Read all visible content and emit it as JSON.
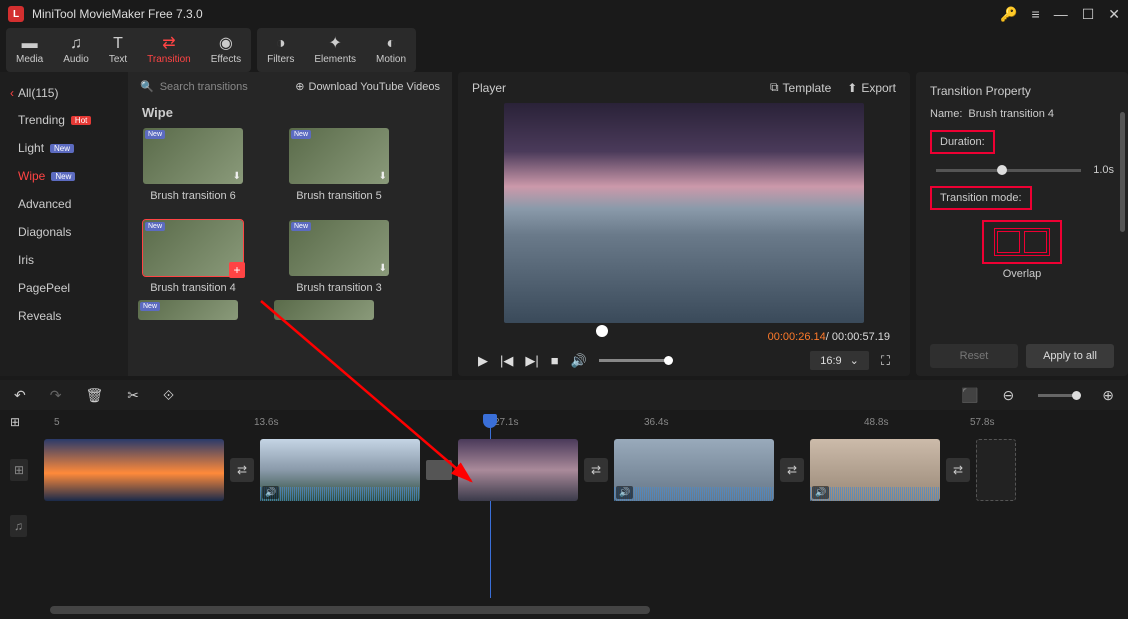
{
  "title": "MiniTool MovieMaker Free 7.3.0",
  "toolbar": {
    "media": "Media",
    "audio": "Audio",
    "text": "Text",
    "transition": "Transition",
    "effects": "Effects",
    "filters": "Filters",
    "elements": "Elements",
    "motion": "Motion"
  },
  "sidebar": {
    "all": "All(115)",
    "items": [
      {
        "label": "Trending",
        "badge": "Hot"
      },
      {
        "label": "Light",
        "badge": "New"
      },
      {
        "label": "Wipe",
        "badge": "New",
        "active": true
      },
      {
        "label": "Advanced"
      },
      {
        "label": "Diagonals"
      },
      {
        "label": "Iris"
      },
      {
        "label": "PagePeel"
      },
      {
        "label": "Reveals"
      }
    ]
  },
  "browser": {
    "search_placeholder": "Search transitions",
    "download": "Download YouTube Videos",
    "section_title": "Wipe",
    "thumbs": [
      "Brush transition 6",
      "Brush transition 5",
      "Brush transition 4",
      "Brush transition 3"
    ]
  },
  "player": {
    "title": "Player",
    "template": "Template",
    "export": "Export",
    "time_current": "00:00:26.14",
    "time_total": "00:00:57.19",
    "ratio": "16:9"
  },
  "props": {
    "title": "Transition Property",
    "name_label": "Name:",
    "name_value": "Brush transition 4",
    "duration_label": "Duration:",
    "duration_value": "1.0s",
    "mode_label": "Transition mode:",
    "overlap": "Overlap",
    "reset": "Reset",
    "apply": "Apply to all"
  },
  "timeline": {
    "ticks": [
      "5",
      "13.6s",
      "27.1s",
      "36.4s",
      "48.8s",
      "57.8s"
    ]
  }
}
